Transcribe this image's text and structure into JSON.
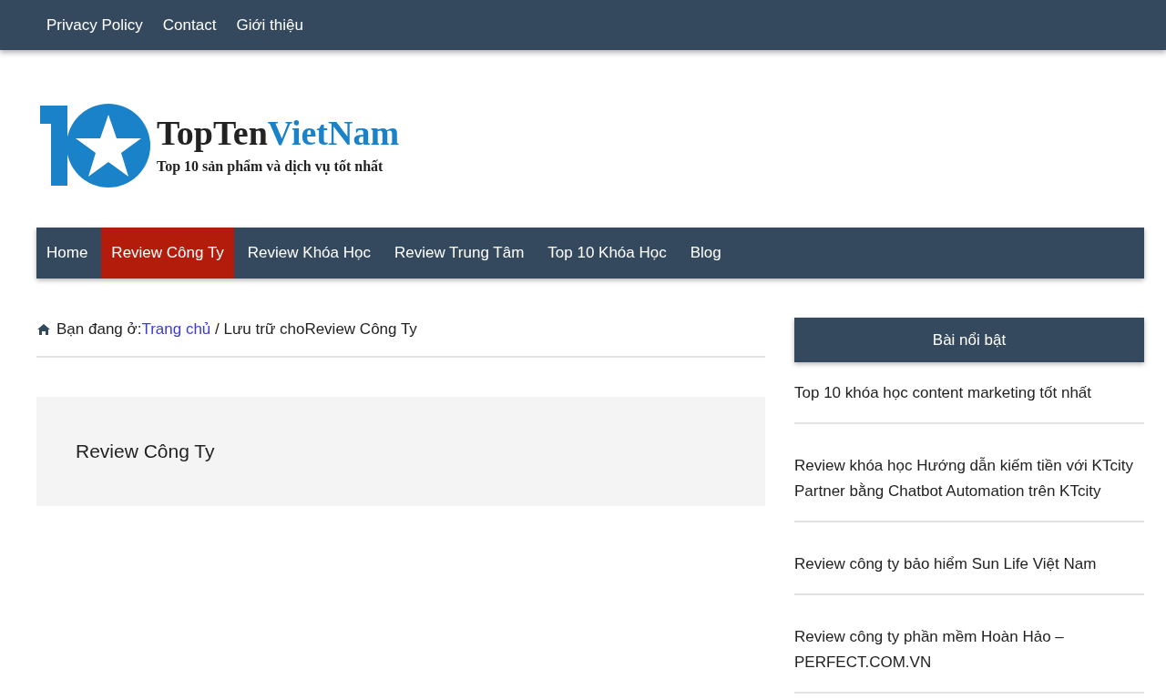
{
  "top_menu": [
    {
      "label": "Privacy Policy"
    },
    {
      "label": "Contact"
    },
    {
      "label": "Giới thiệu"
    }
  ],
  "logo": {
    "title_part_1": "TopTen",
    "title_part_2": "VietNam",
    "tagline": "Top 10 sản phẩm và dịch vụ tốt nhất"
  },
  "main_nav": [
    {
      "label": "Home",
      "selected": false
    },
    {
      "label": "Review Công Ty",
      "selected": true
    },
    {
      "label": "Review Khóa Học",
      "selected": false
    },
    {
      "label": "Review Trung Tâm",
      "selected": false
    },
    {
      "label": "Top 10 Khóa Học",
      "selected": false
    },
    {
      "label": "Blog",
      "selected": false
    }
  ],
  "breadcrumb": {
    "prefix": "Bạn đang ở:",
    "link": "Trang chủ",
    "rest": " / Lưu trữ choReview Công Ty"
  },
  "archive_title": "Review Công Ty",
  "sidebar": {
    "heading": "Bài nổi bật",
    "posts": [
      {
        "title": "Top 10 khóa học content marketing tốt nhất"
      },
      {
        "title": "Review khóa học Hướng dẫn kiếm tiền với KTcity Partner bằng Chatbot Automation trên KTcity"
      },
      {
        "title": "Review công ty bảo hiểm Sun Life Việt Nam"
      },
      {
        "title": "Review công ty phần mềm Hoàn Hảo – PERFECT.COM.VN"
      }
    ]
  }
}
